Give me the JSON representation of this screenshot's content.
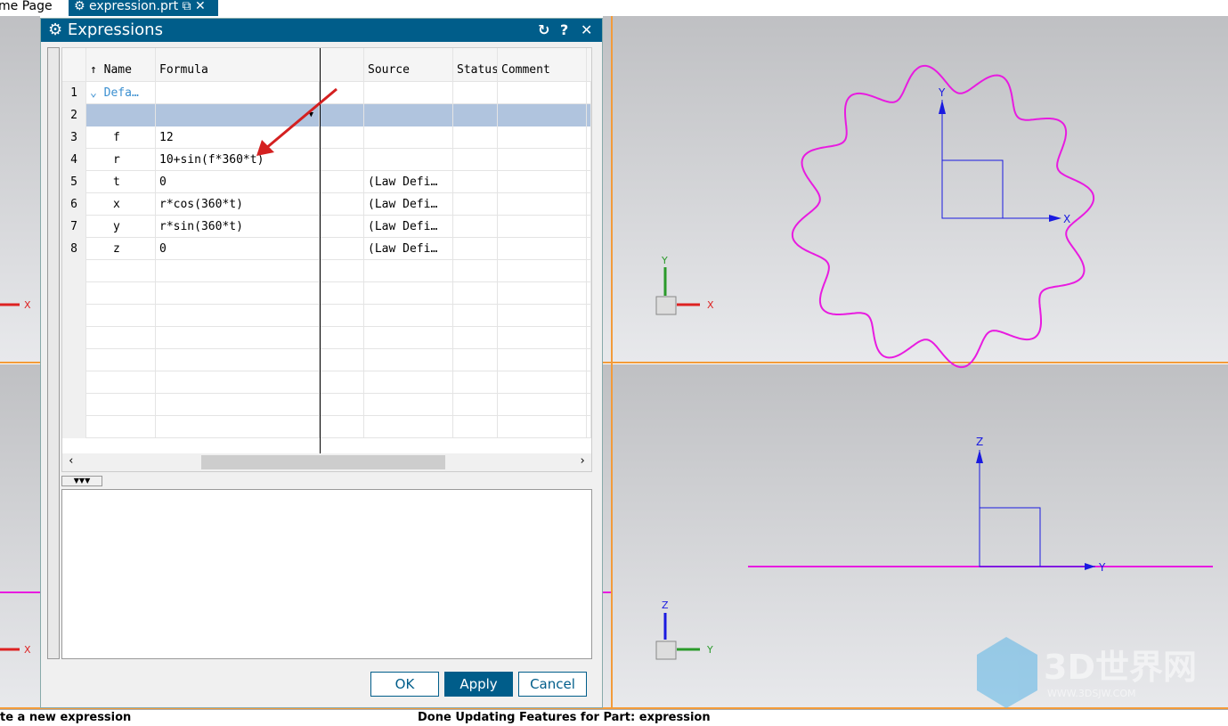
{
  "tabs": [
    {
      "label": "me Page"
    },
    {
      "label": "expression.prt",
      "icons": [
        "pin-icon",
        "close-icon"
      ]
    }
  ],
  "dialog": {
    "title": "Expressions",
    "icons": [
      "gear-icon",
      "reset-icon",
      "help-icon",
      "close-icon"
    ],
    "columns": [
      "Name",
      "Formula",
      "Source",
      "Status",
      "Comment"
    ],
    "rows": [
      {
        "num": "1",
        "name": "Defa…",
        "formula": "",
        "source": ""
      },
      {
        "num": "2",
        "name": "",
        "formula": "",
        "source": ""
      },
      {
        "num": "3",
        "name": "f",
        "formula": "12",
        "source": ""
      },
      {
        "num": "4",
        "name": "r",
        "formula": "10+sin(f*360*t)",
        "source": ""
      },
      {
        "num": "5",
        "name": "t",
        "formula": "0",
        "source": "(Law Defi…"
      },
      {
        "num": "6",
        "name": "x",
        "formula": "r*cos(360*t)",
        "source": "(Law Defi…"
      },
      {
        "num": "7",
        "name": "y",
        "formula": "r*sin(360*t)",
        "source": "(Law Defi…"
      },
      {
        "num": "8",
        "name": "z",
        "formula": "0",
        "source": "(Law Defi…"
      }
    ],
    "ok": "OK",
    "apply": "Apply",
    "cancel": "Cancel"
  },
  "viewports": {
    "top_axes": [
      "X",
      "Y"
    ],
    "front_axes": [
      "Y",
      "Z"
    ],
    "triad_top": [
      "X",
      "Y"
    ],
    "triad_front": [
      "Y",
      "Z"
    ]
  },
  "watermark": {
    "brand": "3D世界网",
    "url": "WWW.3DSJW.COM"
  },
  "status": {
    "left": "te a new expression",
    "right": "Done Updating Features for Part: expression"
  },
  "colors": {
    "accent": "#005d8a",
    "curve": "#e81be0",
    "axis": "#1a1ae0",
    "border": "#f39b3a"
  }
}
